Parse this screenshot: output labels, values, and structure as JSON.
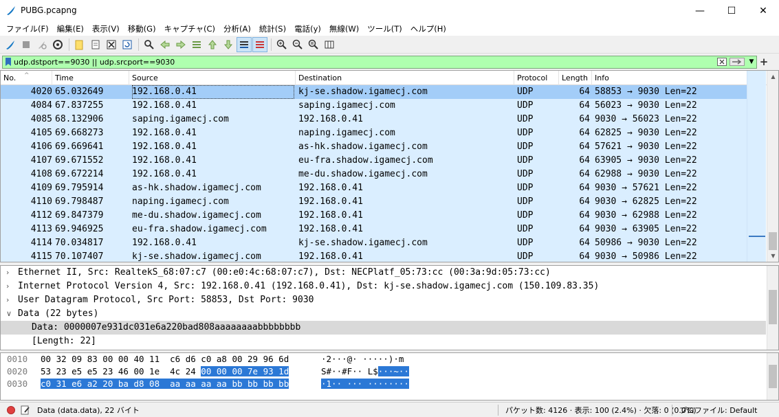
{
  "window": {
    "title": "PUBG.pcapng",
    "minimize": "—",
    "maximize": "☐",
    "close": "✕"
  },
  "menu": [
    "ファイル(F)",
    "編集(E)",
    "表示(V)",
    "移動(G)",
    "キャプチャ(C)",
    "分析(A)",
    "統計(S)",
    "電話(y)",
    "無線(W)",
    "ツール(T)",
    "ヘルプ(H)"
  ],
  "filter": {
    "value": "udp.dstport==9030 || udp.srcport==9030",
    "color": "#afffaf"
  },
  "columns": [
    "No.",
    "Time",
    "Source",
    "Destination",
    "Protocol",
    "Length",
    "Info"
  ],
  "packets": [
    {
      "no": "4020",
      "time": "65.032649",
      "src": "192.168.0.41",
      "dst": "kj-se.shadow.igamecj.com",
      "proto": "UDP",
      "len": "64",
      "info": "58853 → 9030 Len=22",
      "selected": true
    },
    {
      "no": "4084",
      "time": "67.837255",
      "src": "192.168.0.41",
      "dst": "saping.igamecj.com",
      "proto": "UDP",
      "len": "64",
      "info": "56023 → 9030 Len=22"
    },
    {
      "no": "4085",
      "time": "68.132906",
      "src": "saping.igamecj.com",
      "dst": "192.168.0.41",
      "proto": "UDP",
      "len": "64",
      "info": "9030 → 56023 Len=22"
    },
    {
      "no": "4105",
      "time": "69.668273",
      "src": "192.168.0.41",
      "dst": "naping.igamecj.com",
      "proto": "UDP",
      "len": "64",
      "info": "62825 → 9030 Len=22"
    },
    {
      "no": "4106",
      "time": "69.669641",
      "src": "192.168.0.41",
      "dst": "as-hk.shadow.igamecj.com",
      "proto": "UDP",
      "len": "64",
      "info": "57621 → 9030 Len=22"
    },
    {
      "no": "4107",
      "time": "69.671552",
      "src": "192.168.0.41",
      "dst": "eu-fra.shadow.igamecj.com",
      "proto": "UDP",
      "len": "64",
      "info": "63905 → 9030 Len=22"
    },
    {
      "no": "4108",
      "time": "69.672214",
      "src": "192.168.0.41",
      "dst": "me-du.shadow.igamecj.com",
      "proto": "UDP",
      "len": "64",
      "info": "62988 → 9030 Len=22"
    },
    {
      "no": "4109",
      "time": "69.795914",
      "src": "as-hk.shadow.igamecj.com",
      "dst": "192.168.0.41",
      "proto": "UDP",
      "len": "64",
      "info": "9030 → 57621 Len=22"
    },
    {
      "no": "4110",
      "time": "69.798487",
      "src": "naping.igamecj.com",
      "dst": "192.168.0.41",
      "proto": "UDP",
      "len": "64",
      "info": "9030 → 62825 Len=22"
    },
    {
      "no": "4112",
      "time": "69.847379",
      "src": "me-du.shadow.igamecj.com",
      "dst": "192.168.0.41",
      "proto": "UDP",
      "len": "64",
      "info": "9030 → 62988 Len=22"
    },
    {
      "no": "4113",
      "time": "69.946925",
      "src": "eu-fra.shadow.igamecj.com",
      "dst": "192.168.0.41",
      "proto": "UDP",
      "len": "64",
      "info": "9030 → 63905 Len=22"
    },
    {
      "no": "4114",
      "time": "70.034817",
      "src": "192.168.0.41",
      "dst": "kj-se.shadow.igamecj.com",
      "proto": "UDP",
      "len": "64",
      "info": "50986 → 9030 Len=22"
    },
    {
      "no": "4115",
      "time": "70.107407",
      "src": "kj-se.shadow.igamecj.com",
      "dst": "192.168.0.41",
      "proto": "UDP",
      "len": "64",
      "info": "9030 → 50986 Len=22"
    }
  ],
  "details": [
    {
      "toggle": "›",
      "text": "Ethernet II, Src: RealtekS_68:07:c7 (00:e0:4c:68:07:c7), Dst: NECPlatf_05:73:cc (00:3a:9d:05:73:cc)"
    },
    {
      "toggle": "›",
      "text": "Internet Protocol Version 4, Src: 192.168.0.41 (192.168.0.41), Dst: kj-se.shadow.igamecj.com (150.109.83.35)"
    },
    {
      "toggle": "›",
      "text": "User Datagram Protocol, Src Port: 58853, Dst Port: 9030"
    },
    {
      "toggle": "∨",
      "text": "Data (22 bytes)"
    },
    {
      "toggle": "",
      "text": "Data: 0000007e931dc031e6a220bad808aaaaaaaabbbbbbbb",
      "sub": true,
      "highlighted": true
    },
    {
      "toggle": "",
      "text": "[Length: 22]",
      "sub": true
    }
  ],
  "bytes": [
    {
      "offset": "0010",
      "hex_plain": "00 32 09 83 00 00 40 11  c6 d6 c0 a8 00 29 96 6d",
      "hex_hl": "",
      "ascii_plain": "·2···@· ·····)·m",
      "ascii_hl": ""
    },
    {
      "offset": "0020",
      "hex_plain": "53 23 e5 e5 23 46 00 1e  4c 24 ",
      "hex_hl": "00 00 00 7e 93 1d",
      "ascii_plain": "S#··#F·· L$",
      "ascii_hl": "···~··"
    },
    {
      "offset": "0030",
      "hex_plain": "",
      "hex_hl": "c0 31 e6 a2 20 ba d8 08  aa aa aa aa bb bb bb bb",
      "ascii_plain": "",
      "ascii_hl": "·1·· ··· ········"
    }
  ],
  "status": {
    "field": "Data (data.data), 22 バイト",
    "counts": "パケット数: 4126 · 表示: 100 (2.4%) · 欠落: 0 (0.0%)",
    "profile": "プロファイル: Default"
  }
}
